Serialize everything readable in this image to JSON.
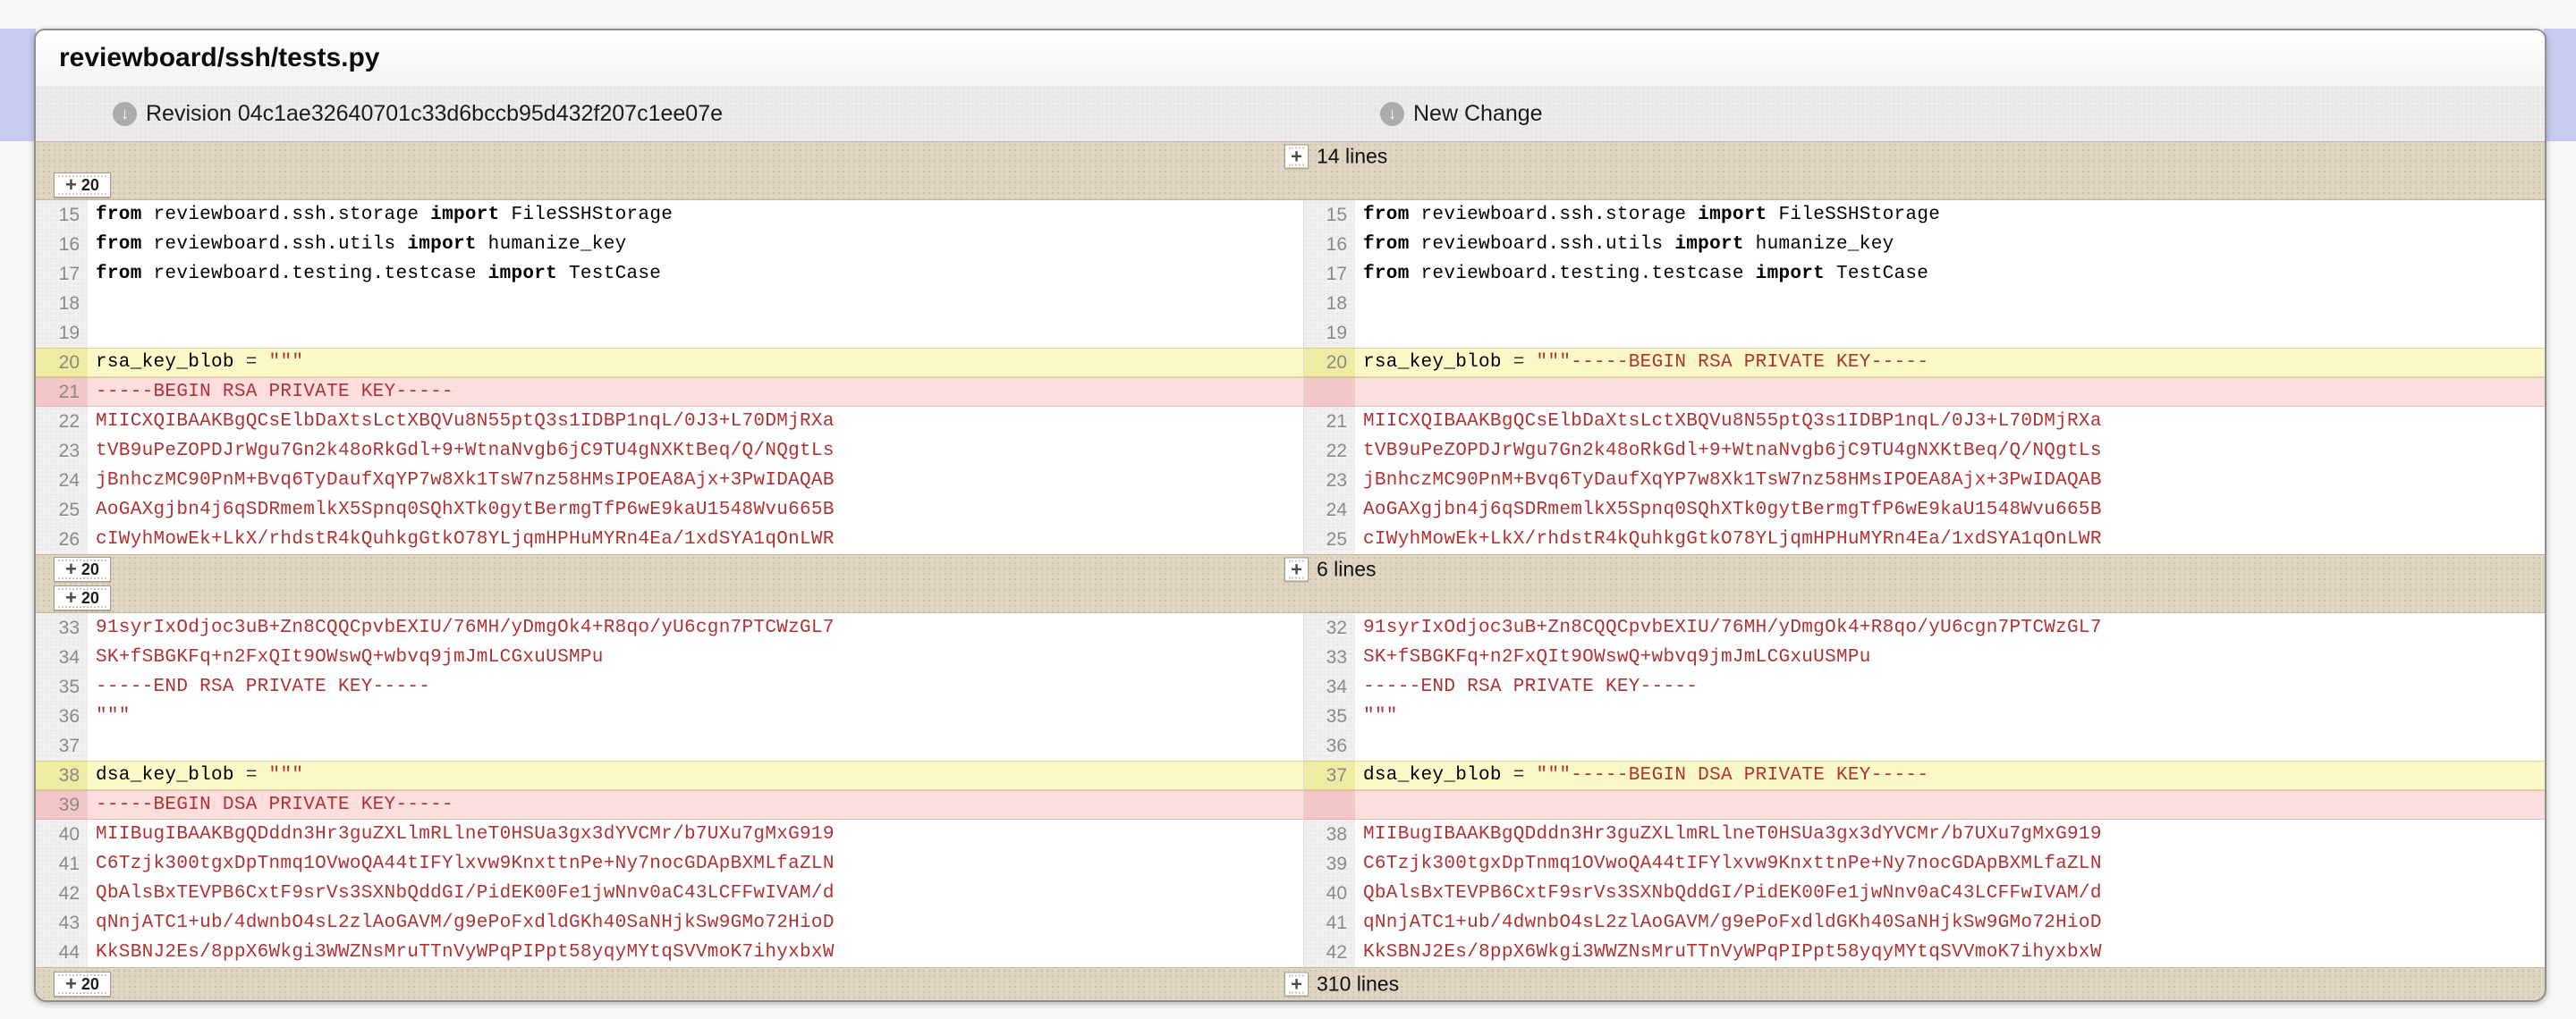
{
  "file": {
    "path": "reviewboard/ssh/tests.py"
  },
  "revisions": {
    "left": {
      "label": "Revision 04c1ae32640701c33d6bccb95d432f207c1ee07e"
    },
    "right": {
      "label": "New Change"
    }
  },
  "icons": {
    "download": "↓",
    "expand_plus": "+"
  },
  "expand": {
    "step": "20"
  },
  "colors": {
    "accent_strip": "#c9caf2",
    "band_bg": "#e0d4c2",
    "replace_bg": "#fbf8c8",
    "replace_gutter_bg": "#f0eba2",
    "delete_bg": "#fcdede",
    "delete_gutter_bg": "#f3c7c6",
    "string_text": "#b03232",
    "line_number_text": "#8a8a8a"
  },
  "diff": {
    "rows": [
      {
        "t": "band",
        "layout": "top",
        "label": "14 lines"
      },
      {
        "t": "line",
        "l": {
          "n": "15",
          "bg": "eq",
          "seg": [
            [
              "k",
              "from"
            ],
            [
              "p",
              " reviewboard.ssh.storage "
            ],
            [
              "k",
              "import"
            ],
            [
              "p",
              " FileSSHStorage"
            ]
          ]
        },
        "r": {
          "n": "15",
          "bg": "eq",
          "seg": [
            [
              "k",
              "from"
            ],
            [
              "p",
              " reviewboard.ssh.storage "
            ],
            [
              "k",
              "import"
            ],
            [
              "p",
              " FileSSHStorage"
            ]
          ]
        }
      },
      {
        "t": "line",
        "l": {
          "n": "16",
          "bg": "eq",
          "seg": [
            [
              "k",
              "from"
            ],
            [
              "p",
              " reviewboard.ssh.utils "
            ],
            [
              "k",
              "import"
            ],
            [
              "p",
              " humanize_key"
            ]
          ]
        },
        "r": {
          "n": "16",
          "bg": "eq",
          "seg": [
            [
              "k",
              "from"
            ],
            [
              "p",
              " reviewboard.ssh.utils "
            ],
            [
              "k",
              "import"
            ],
            [
              "p",
              " humanize_key"
            ]
          ]
        }
      },
      {
        "t": "line",
        "l": {
          "n": "17",
          "bg": "eq",
          "seg": [
            [
              "k",
              "from"
            ],
            [
              "p",
              " reviewboard.testing.testcase "
            ],
            [
              "k",
              "import"
            ],
            [
              "p",
              " TestCase"
            ]
          ]
        },
        "r": {
          "n": "17",
          "bg": "eq",
          "seg": [
            [
              "k",
              "from"
            ],
            [
              "p",
              " reviewboard.testing.testcase "
            ],
            [
              "k",
              "import"
            ],
            [
              "p",
              " TestCase"
            ]
          ]
        }
      },
      {
        "t": "line",
        "l": {
          "n": "18",
          "bg": "eq",
          "seg": []
        },
        "r": {
          "n": "18",
          "bg": "eq",
          "seg": []
        }
      },
      {
        "t": "line",
        "l": {
          "n": "19",
          "bg": "eq",
          "seg": []
        },
        "r": {
          "n": "19",
          "bg": "eq",
          "seg": []
        }
      },
      {
        "t": "line",
        "l": {
          "n": "20",
          "bg": "rep",
          "seg": [
            [
              "p",
              "rsa_key_blob "
            ],
            [
              "o",
              "= "
            ],
            [
              "s",
              "\"\"\""
            ]
          ]
        },
        "r": {
          "n": "20",
          "bg": "rep",
          "seg": [
            [
              "p",
              "rsa_key_blob "
            ],
            [
              "o",
              "= "
            ],
            [
              "s",
              "\"\"\"-----BEGIN RSA PRIVATE KEY-----"
            ]
          ]
        }
      },
      {
        "t": "line",
        "l": {
          "n": "21",
          "bg": "del",
          "seg": [
            [
              "s",
              "-----BEGIN RSA PRIVATE KEY-----"
            ]
          ]
        },
        "r": {
          "n": "",
          "bg": "del",
          "seg": []
        }
      },
      {
        "t": "line",
        "l": {
          "n": "22",
          "bg": "eq",
          "seg": [
            [
              "s",
              "MIICXQIBAAKBgQCsElbDaXtsLctXBQVu8N55ptQ3s1IDBP1nqL/0J3+L70DMjRXa"
            ]
          ]
        },
        "r": {
          "n": "21",
          "bg": "eq",
          "seg": [
            [
              "s",
              "MIICXQIBAAKBgQCsElbDaXtsLctXBQVu8N55ptQ3s1IDBP1nqL/0J3+L70DMjRXa"
            ]
          ]
        }
      },
      {
        "t": "line",
        "l": {
          "n": "23",
          "bg": "eq",
          "seg": [
            [
              "s",
              "tVB9uPeZOPDJrWgu7Gn2k48oRkGdl+9+WtnaNvgb6jC9TU4gNXKtBeq/Q/NQgtLs"
            ]
          ]
        },
        "r": {
          "n": "22",
          "bg": "eq",
          "seg": [
            [
              "s",
              "tVB9uPeZOPDJrWgu7Gn2k48oRkGdl+9+WtnaNvgb6jC9TU4gNXKtBeq/Q/NQgtLs"
            ]
          ]
        }
      },
      {
        "t": "line",
        "l": {
          "n": "24",
          "bg": "eq",
          "seg": [
            [
              "s",
              "jBnhczMC90PnM+Bvq6TyDaufXqYP7w8Xk1TsW7nz58HMsIPOEA8Ajx+3PwIDAQAB"
            ]
          ]
        },
        "r": {
          "n": "23",
          "bg": "eq",
          "seg": [
            [
              "s",
              "jBnhczMC90PnM+Bvq6TyDaufXqYP7w8Xk1TsW7nz58HMsIPOEA8Ajx+3PwIDAQAB"
            ]
          ]
        }
      },
      {
        "t": "line",
        "l": {
          "n": "25",
          "bg": "eq",
          "seg": [
            [
              "s",
              "AoGAXgjbn4j6qSDRmemlkX5Spnq0SQhXTk0gytBermgTfP6wE9kaU1548Wvu665B"
            ]
          ]
        },
        "r": {
          "n": "24",
          "bg": "eq",
          "seg": [
            [
              "s",
              "AoGAXgjbn4j6qSDRmemlkX5Spnq0SQhXTk0gytBermgTfP6wE9kaU1548Wvu665B"
            ]
          ]
        }
      },
      {
        "t": "line",
        "l": {
          "n": "26",
          "bg": "eq",
          "seg": [
            [
              "s",
              "cIWyhMowEk+LkX/rhdstR4kQuhkgGtkO78YLjqmHPHuMYRn4Ea/1xdSYA1qOnLWR"
            ]
          ]
        },
        "r": {
          "n": "25",
          "bg": "eq",
          "seg": [
            [
              "s",
              "cIWyhMowEk+LkX/rhdstR4kQuhkgGtkO78YLjqmHPHuMYRn4Ea/1xdSYA1qOnLWR"
            ]
          ]
        }
      },
      {
        "t": "band",
        "layout": "mid",
        "label": "6 lines"
      },
      {
        "t": "line",
        "l": {
          "n": "33",
          "bg": "eq",
          "seg": [
            [
              "s",
              "91syrIxOdjoc3uB+Zn8CQQCpvbEXIU/76MH/yDmgOk4+R8qo/yU6cgn7PTCWzGL7"
            ]
          ]
        },
        "r": {
          "n": "32",
          "bg": "eq",
          "seg": [
            [
              "s",
              "91syrIxOdjoc3uB+Zn8CQQCpvbEXIU/76MH/yDmgOk4+R8qo/yU6cgn7PTCWzGL7"
            ]
          ]
        }
      },
      {
        "t": "line",
        "l": {
          "n": "34",
          "bg": "eq",
          "seg": [
            [
              "s",
              "SK+fSBGKFq+n2FxQIt9OWswQ+wbvq9jmJmLCGxuUSMPu"
            ]
          ]
        },
        "r": {
          "n": "33",
          "bg": "eq",
          "seg": [
            [
              "s",
              "SK+fSBGKFq+n2FxQIt9OWswQ+wbvq9jmJmLCGxuUSMPu"
            ]
          ]
        }
      },
      {
        "t": "line",
        "l": {
          "n": "35",
          "bg": "eq",
          "seg": [
            [
              "s",
              "-----END RSA PRIVATE KEY-----"
            ]
          ]
        },
        "r": {
          "n": "34",
          "bg": "eq",
          "seg": [
            [
              "s",
              "-----END RSA PRIVATE KEY-----"
            ]
          ]
        }
      },
      {
        "t": "line",
        "l": {
          "n": "36",
          "bg": "eq",
          "seg": [
            [
              "s",
              "\"\"\""
            ]
          ]
        },
        "r": {
          "n": "35",
          "bg": "eq",
          "seg": [
            [
              "s",
              "\"\"\""
            ]
          ]
        }
      },
      {
        "t": "line",
        "l": {
          "n": "37",
          "bg": "eq",
          "seg": []
        },
        "r": {
          "n": "36",
          "bg": "eq",
          "seg": []
        }
      },
      {
        "t": "line",
        "l": {
          "n": "38",
          "bg": "rep",
          "seg": [
            [
              "p",
              "dsa_key_blob "
            ],
            [
              "o",
              "= "
            ],
            [
              "s",
              "\"\"\""
            ]
          ]
        },
        "r": {
          "n": "37",
          "bg": "rep",
          "seg": [
            [
              "p",
              "dsa_key_blob "
            ],
            [
              "o",
              "= "
            ],
            [
              "s",
              "\"\"\"-----BEGIN DSA PRIVATE KEY-----"
            ]
          ]
        }
      },
      {
        "t": "line",
        "l": {
          "n": "39",
          "bg": "del",
          "seg": [
            [
              "s",
              "-----BEGIN DSA PRIVATE KEY-----"
            ]
          ]
        },
        "r": {
          "n": "",
          "bg": "del",
          "seg": []
        }
      },
      {
        "t": "line",
        "l": {
          "n": "40",
          "bg": "eq",
          "seg": [
            [
              "s",
              "MIIBugIBAAKBgQDddn3Hr3guZXLlmRLlneT0HSUa3gx3dYVCMr/b7UXu7gMxG919"
            ]
          ]
        },
        "r": {
          "n": "38",
          "bg": "eq",
          "seg": [
            [
              "s",
              "MIIBugIBAAKBgQDddn3Hr3guZXLlmRLlneT0HSUa3gx3dYVCMr/b7UXu7gMxG919"
            ]
          ]
        }
      },
      {
        "t": "line",
        "l": {
          "n": "41",
          "bg": "eq",
          "seg": [
            [
              "s",
              "C6Tzjk300tgxDpTnmq1OVwoQA44tIFYlxvw9KnxttnPe+Ny7nocGDApBXMLfaZLN"
            ]
          ]
        },
        "r": {
          "n": "39",
          "bg": "eq",
          "seg": [
            [
              "s",
              "C6Tzjk300tgxDpTnmq1OVwoQA44tIFYlxvw9KnxttnPe+Ny7nocGDApBXMLfaZLN"
            ]
          ]
        }
      },
      {
        "t": "line",
        "l": {
          "n": "42",
          "bg": "eq",
          "seg": [
            [
              "s",
              "QbAlsBxTEVPB6CxtF9srVs3SXNbQddGI/PidEK00Fe1jwNnv0aC43LCFFwIVAM/d"
            ]
          ]
        },
        "r": {
          "n": "40",
          "bg": "eq",
          "seg": [
            [
              "s",
              "QbAlsBxTEVPB6CxtF9srVs3SXNbQddGI/PidEK00Fe1jwNnv0aC43LCFFwIVAM/d"
            ]
          ]
        }
      },
      {
        "t": "line",
        "l": {
          "n": "43",
          "bg": "eq",
          "seg": [
            [
              "s",
              "qNnjATC1+ub/4dwnbO4sL2zlAoGAVM/g9ePoFxdldGKh40SaNHjkSw9GMo72HioD"
            ]
          ]
        },
        "r": {
          "n": "41",
          "bg": "eq",
          "seg": [
            [
              "s",
              "qNnjATC1+ub/4dwnbO4sL2zlAoGAVM/g9ePoFxdldGKh40SaNHjkSw9GMo72HioD"
            ]
          ]
        }
      },
      {
        "t": "line",
        "l": {
          "n": "44",
          "bg": "eq",
          "seg": [
            [
              "s",
              "KkSBNJ2Es/8ppX6Wkgi3WWZNsMruTTnVyWPqPIPpt58yqyMYtqSVVmoK7ihyxbxW"
            ]
          ]
        },
        "r": {
          "n": "42",
          "bg": "eq",
          "seg": [
            [
              "s",
              "KkSBNJ2Es/8ppX6Wkgi3WWZNsMruTTnVyWPqPIPpt58yqyMYtqSVVmoK7ihyxbxW"
            ]
          ]
        }
      },
      {
        "t": "band",
        "layout": "bottom",
        "label": "310 lines"
      }
    ]
  }
}
